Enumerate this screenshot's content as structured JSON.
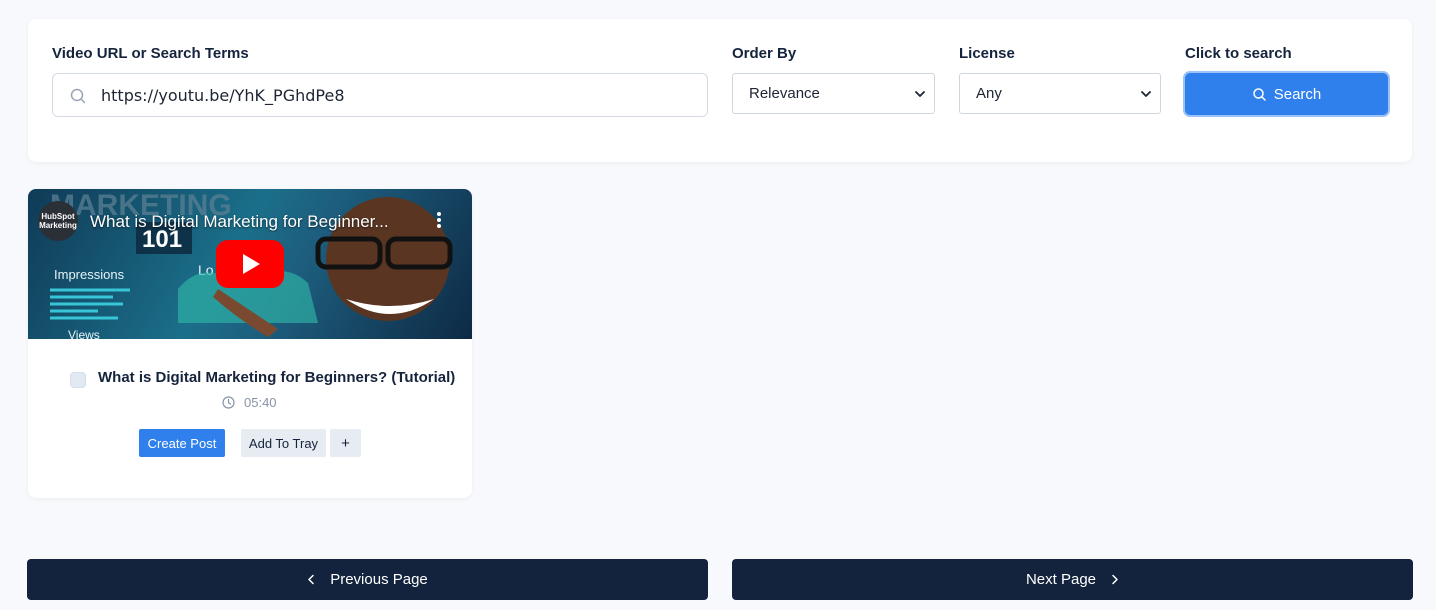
{
  "search_panel": {
    "url_label": "Video URL or Search Terms",
    "url_value": "https://youtu.be/YhK_PGhdPe8",
    "order_label": "Order By",
    "order_value": "Relevance",
    "license_label": "License",
    "license_value": "Any",
    "search_label": "Click to search",
    "search_button": "Search"
  },
  "video_card": {
    "thumbnail_title": "What is Digital Marketing for Beginner...",
    "channel_name": "HubSpot Marketing",
    "thumbnail_texts": {
      "heading": "MARKETING",
      "number": "101",
      "metric_1": "Impressions",
      "metric_2": "Views",
      "partial": "Lo"
    },
    "title": "What is Digital Marketing for Beginners? (Tutorial)",
    "duration": "05:40",
    "create_post_button": "Create Post",
    "add_tray_button": "Add To Tray",
    "plus_button": "+"
  },
  "pagination": {
    "previous": "Previous Page",
    "next": "Next Page"
  },
  "icons": {
    "search": "search-icon",
    "chevron": "chevron-down-icon",
    "clock": "clock-icon",
    "play": "play-icon",
    "kebab": "kebab-icon",
    "chevron_left": "chevron-left-icon",
    "chevron_right": "chevron-right-icon"
  },
  "colors": {
    "primary": "#2f80ed",
    "dark": "#13233d",
    "background": "#f7f9fc",
    "youtube_red": "#ff0000"
  }
}
